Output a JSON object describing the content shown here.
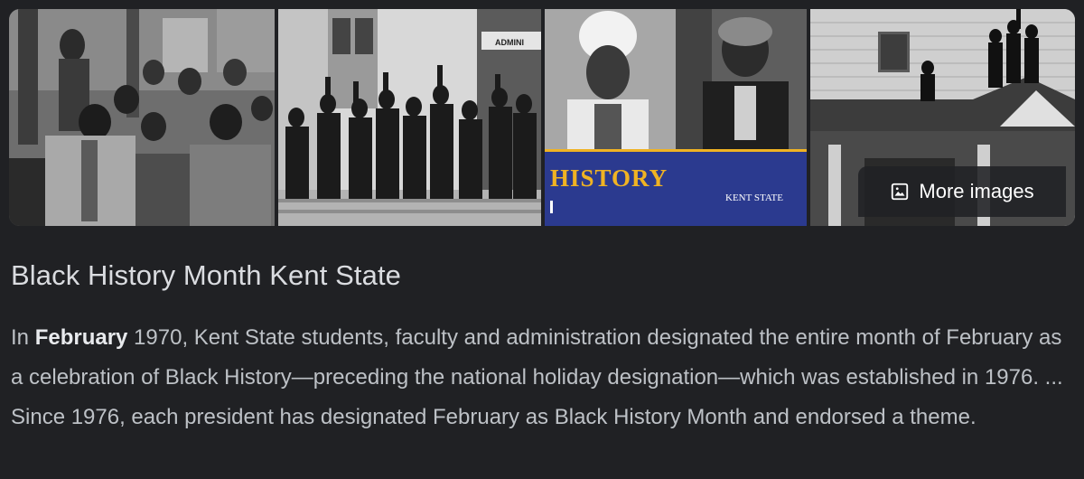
{
  "images": {
    "more_label": "More images",
    "banner": {
      "history_text": "HISTORY",
      "logo_text": "KENT STATE",
      "sign_text": "ADMINI"
    }
  },
  "result": {
    "title": "Black History Month Kent State",
    "snippet": {
      "lead": "In ",
      "bold": "February",
      "rest": " 1970, Kent State students, faculty and administration designated the entire month of February as a celebration of Black History—preceding the national holiday designation—which was established in 1976. ... Since 1976, each president has designated February as Black History Month and endorsed a theme."
    }
  },
  "colors": {
    "background": "#202124",
    "title": "#dadce0",
    "text": "#bdc1c6",
    "banner_blue": "#2b3a8f",
    "banner_gold": "#f0b323"
  }
}
